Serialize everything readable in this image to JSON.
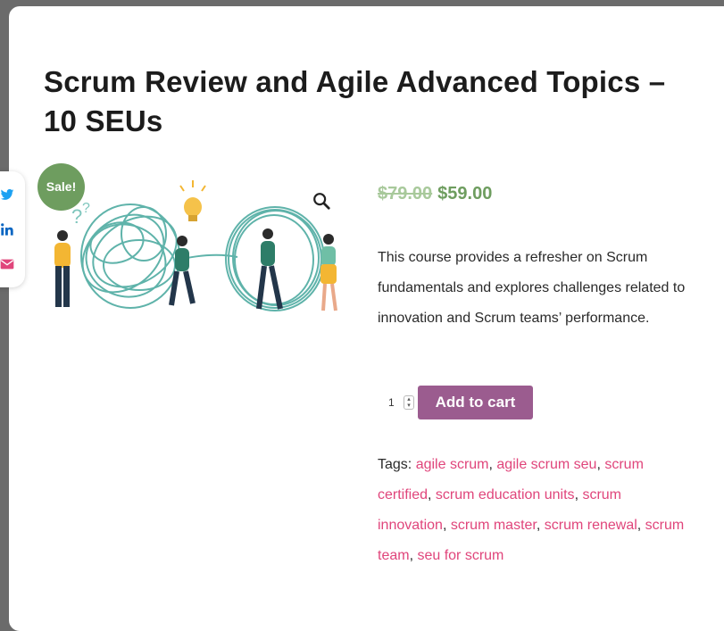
{
  "product": {
    "title": "Scrum Review and Agile Advanced Topics – 10 SEUs",
    "sale_badge": "Sale!",
    "price_old": "$79.00",
    "price_new": "$59.00",
    "description": "This course provides a refresher on Scrum fundamentals and explores challenges related to innovation and Scrum teams’ performance.",
    "quantity": "1",
    "add_to_cart_label": "Add to cart",
    "tags_label": "Tags:",
    "tags": [
      "agile scrum",
      "agile scrum seu",
      "scrum certified",
      "scrum education units",
      "scrum innovation",
      "scrum master",
      "scrum renewal",
      "scrum team",
      "seu for scrum"
    ]
  },
  "share": {
    "icons": [
      "twitter-icon",
      "linkedin-icon",
      "email-icon"
    ]
  },
  "colors": {
    "sale_green": "#6e9d5f",
    "button_purple": "#9b5c8f",
    "tag_pink": "#e0457b",
    "twitter_blue": "#1da1f2",
    "linkedin_blue": "#0a66c2",
    "email_pink": "#e0457b",
    "illustration_teal": "#5fb3aa"
  }
}
